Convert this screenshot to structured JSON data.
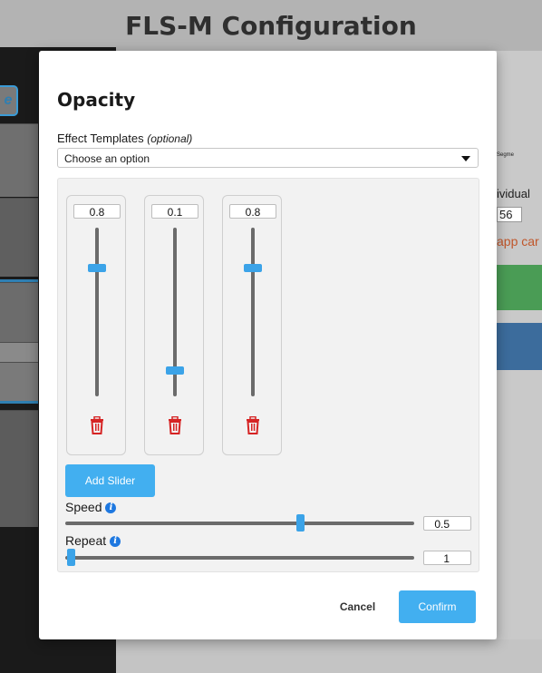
{
  "app": {
    "title": "FLS-M Configuration"
  },
  "background": {
    "left_button_glyph": "e",
    "right_fragment_label": "ividual",
    "right_fragment_value": "56",
    "right_fragment_warning": "app car",
    "right_fragment_caption": "Segme"
  },
  "dialog": {
    "title": "Opacity",
    "templates": {
      "label": "Effect Templates",
      "optional": "(optional)",
      "selected": "Choose an option"
    },
    "sliders": [
      {
        "value": "0.8",
        "level": 0.8
      },
      {
        "value": "0.1",
        "level": 0.1
      },
      {
        "value": "0.8",
        "level": 0.8
      }
    ],
    "add_slider_label": "Add Slider",
    "speed": {
      "label": "Speed",
      "value": "0.5",
      "fraction": 0.68
    },
    "repeat": {
      "label": "Repeat",
      "value": "1",
      "fraction": 0.0
    },
    "cancel_label": "Cancel",
    "confirm_label": "Confirm"
  },
  "icons": {
    "delete": "trash-icon",
    "info": "info-icon",
    "dropdown": "chevron-down-icon"
  },
  "colors": {
    "accent": "#42aff0",
    "delete": "#d62424",
    "info": "#1e78e0"
  }
}
